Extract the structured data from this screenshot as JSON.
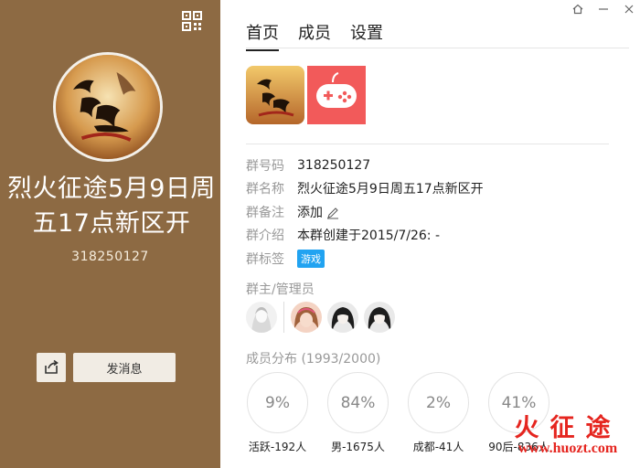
{
  "left": {
    "group_name": "烈火征途5月9日周五17点新区开",
    "group_id": "318250127",
    "send_label": "发消息",
    "bg_color": "#8d6a43"
  },
  "window": {
    "icons": [
      "home-icon",
      "minimize-icon",
      "close-icon"
    ]
  },
  "tabs": [
    {
      "label": "首页",
      "active": true
    },
    {
      "label": "成员",
      "active": false
    },
    {
      "label": "设置",
      "active": false
    }
  ],
  "info": {
    "rows": [
      {
        "label": "群号码",
        "value": "318250127"
      },
      {
        "label": "群名称",
        "value": "烈火征途5月9日周五17点新区开"
      },
      {
        "label": "群备注",
        "value": "添加"
      },
      {
        "label": "群介绍",
        "value": "本群创建于2015/7/26:  -"
      },
      {
        "label": "群标签",
        "value": "游戏"
      }
    ]
  },
  "admins": {
    "title": "群主/管理员"
  },
  "members": {
    "title": "成员分布 (1993/2000)",
    "stats": [
      {
        "percent": "9%",
        "label": "活跃-192人"
      },
      {
        "percent": "84%",
        "label": "男-1675人"
      },
      {
        "percent": "2%",
        "label": "成都-41人"
      },
      {
        "percent": "41%",
        "label": "90后-836人"
      }
    ]
  },
  "watermark": {
    "brand": "火征途",
    "url": "www.huozt.com"
  },
  "colors": {
    "accent_tag": "#21a3f1",
    "watermark": "#e5251f"
  }
}
